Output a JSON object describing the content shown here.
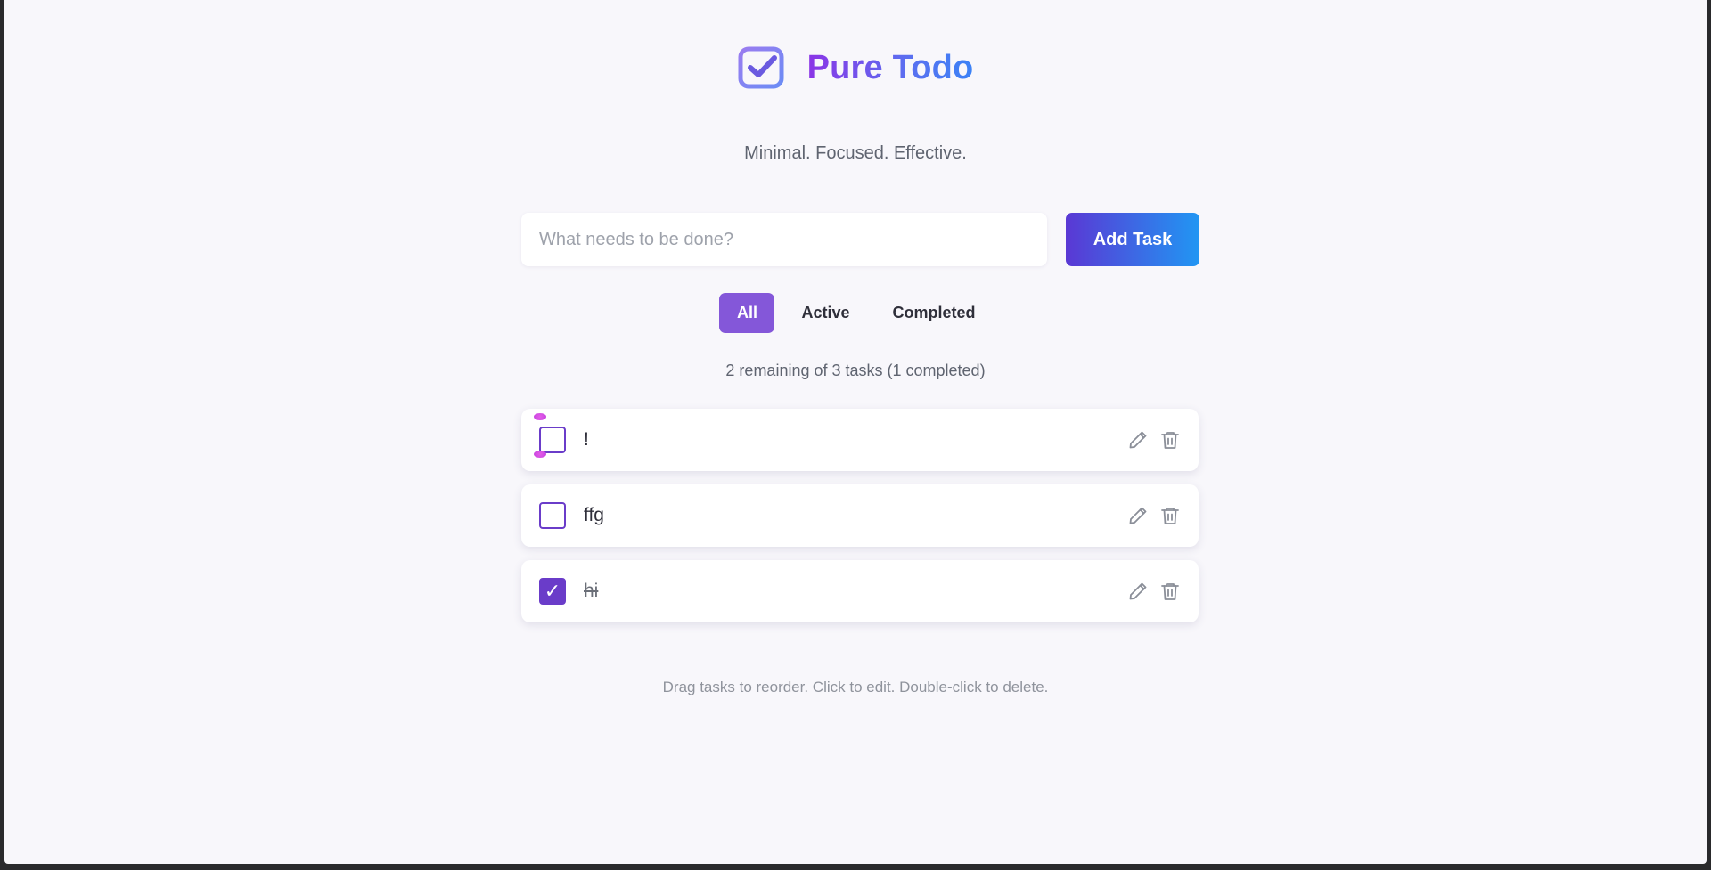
{
  "app": {
    "title": "Pure Todo",
    "subtitle": "Minimal. Focused. Effective.",
    "logo_icon": "check-square-icon"
  },
  "add_task": {
    "input_value": "",
    "placeholder": "What needs to be done?",
    "button_label": "Add Task"
  },
  "filters": [
    {
      "label": "All",
      "active": true
    },
    {
      "label": "Active",
      "active": false
    },
    {
      "label": "Completed",
      "active": false
    }
  ],
  "stats": "2 remaining of 3 tasks (1 completed)",
  "tasks": [
    {
      "text": "!",
      "completed": false
    },
    {
      "text": "ffg",
      "completed": false
    },
    {
      "text": "hi",
      "completed": true
    }
  ],
  "task_actions": {
    "edit_icon": "pencil-icon",
    "delete_icon": "trash-icon"
  },
  "hint": "Drag tasks to reorder. Click to edit. Double-click to delete.",
  "colors": {
    "accent": "#6a3cc9",
    "filter_active": "#8457d9",
    "title_gradient_start": "#8b35e6",
    "title_gradient_end": "#3b82f6",
    "button_gradient_start": "#5a38d4",
    "button_gradient_end": "#2196f3",
    "background": "#f8f7fb"
  }
}
